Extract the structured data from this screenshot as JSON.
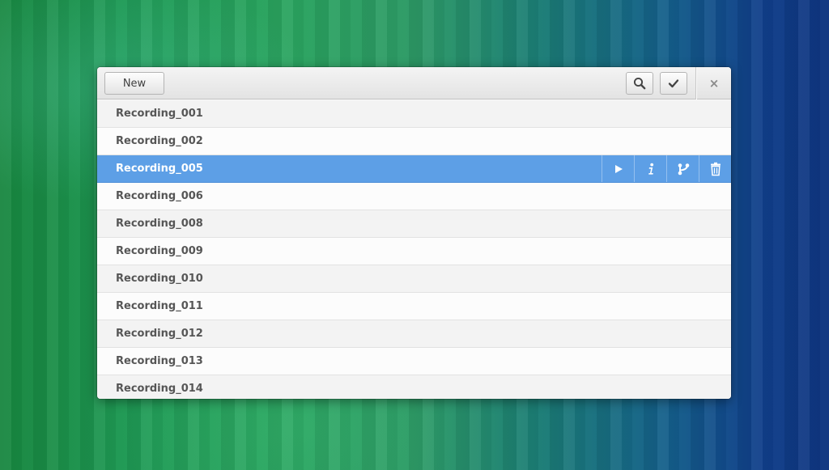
{
  "header": {
    "new_label": "New",
    "search_icon": "search-icon",
    "select_icon": "checkmark-icon",
    "close_label": "×"
  },
  "recordings": [
    {
      "name": "Recording_001",
      "selected": false
    },
    {
      "name": "Recording_002",
      "selected": false
    },
    {
      "name": "Recording_005",
      "selected": true
    },
    {
      "name": "Recording_006",
      "selected": false
    },
    {
      "name": "Recording_008",
      "selected": false
    },
    {
      "name": "Recording_009",
      "selected": false
    },
    {
      "name": "Recording_010",
      "selected": false
    },
    {
      "name": "Recording_011",
      "selected": false
    },
    {
      "name": "Recording_012",
      "selected": false
    },
    {
      "name": "Recording_013",
      "selected": false
    },
    {
      "name": "Recording_014",
      "selected": false
    }
  ],
  "row_actions": [
    "play-icon",
    "info-icon",
    "share-icon",
    "trash-icon"
  ],
  "colors": {
    "selection": "#5d9fe6",
    "row_text": "#565656"
  }
}
